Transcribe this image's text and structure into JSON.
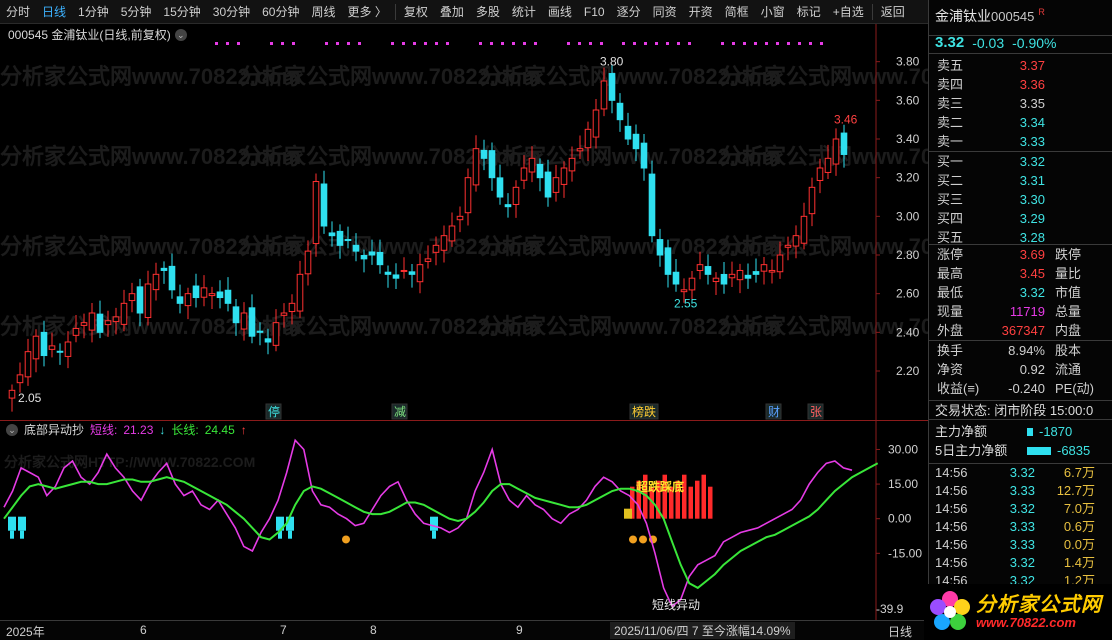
{
  "toolbar": {
    "items": [
      "分时",
      "日线",
      "1分钟",
      "5分钟",
      "15分钟",
      "30分钟",
      "60分钟",
      "周线",
      "更多 〉",
      "复权",
      "叠加",
      "多股",
      "统计",
      "画线",
      "F10",
      "逐分",
      "同资",
      "开资",
      "简框",
      "小窗",
      "标记",
      "+自选",
      "返回"
    ],
    "active": "日线"
  },
  "main": {
    "title": "000545 金浦钛业(日线,前复权)",
    "high_label": "3.80",
    "low_label": "2.55",
    "start_label": "2.05",
    "last_high_label": "3.46",
    "price_ticks": [
      "3.80",
      "3.60",
      "3.40",
      "3.20",
      "3.00",
      "2.80",
      "2.60",
      "2.40",
      "2.20"
    ],
    "event_tags": [
      {
        "text": "停",
        "color": "#3fe3e3"
      },
      {
        "text": "减",
        "color": "#7fe07f"
      },
      {
        "text": "榜跌",
        "color": "#ffcc33"
      },
      {
        "text": "财",
        "color": "#5aa0ff"
      },
      {
        "text": "张",
        "color": "#ff6060"
      }
    ],
    "watermark": "分析家公式网www.70822.com"
  },
  "indicator": {
    "name": "底部异动抄",
    "short_label": "短线:",
    "short_value": "21.23",
    "short_arrow": "↓",
    "long_label": "长线:",
    "long_value": "24.45",
    "long_arrow": "↑",
    "ticks": [
      "30.00",
      "15.00",
      "0.00",
      "-15.00"
    ],
    "min_label": "-39.9",
    "annotation_top": "超跌踩底",
    "annotation_bottom": "短线异动",
    "watermark": "分析家公式网HTTP://WWW.70822.COM"
  },
  "bottom_bar": {
    "year": "2025年",
    "months": [
      "6",
      "7",
      "8",
      "9"
    ],
    "status": "2025/11/06/四 7 至今涨幅14.09%",
    "right": "日线"
  },
  "quote": {
    "name": "金浦钛业",
    "code": "000545",
    "badge": "R",
    "price": "3.32",
    "change": "-0.03",
    "pct": "-0.90%",
    "asks": [
      {
        "label": "卖五",
        "price": "3.37",
        "color": "#ff4040"
      },
      {
        "label": "卖四",
        "price": "3.36",
        "color": "#ff4040"
      },
      {
        "label": "卖三",
        "price": "3.35",
        "color": "#cfcfcf"
      },
      {
        "label": "卖二",
        "price": "3.34",
        "color": "#3fe3e3"
      },
      {
        "label": "卖一",
        "price": "3.33",
        "color": "#3fe3e3"
      }
    ],
    "bids": [
      {
        "label": "买一",
        "price": "3.32",
        "color": "#3fe3e3"
      },
      {
        "label": "买二",
        "price": "3.31",
        "color": "#3fe3e3"
      },
      {
        "label": "买三",
        "price": "3.30",
        "color": "#3fe3e3"
      },
      {
        "label": "买四",
        "price": "3.29",
        "color": "#3fe3e3"
      },
      {
        "label": "买五",
        "price": "3.28",
        "color": "#3fe3e3"
      }
    ],
    "stats": [
      {
        "l1": "涨停",
        "v1": "3.69",
        "c1": "#ff4040",
        "l2": "跌停"
      },
      {
        "l1": "最高",
        "v1": "3.45",
        "c1": "#ff4040",
        "l2": "量比"
      },
      {
        "l1": "最低",
        "v1": "3.32",
        "c1": "#3fe3e3",
        "l2": "市值"
      },
      {
        "l1": "现量",
        "v1": "11719",
        "c1": "#e53be5",
        "l2": "总量"
      },
      {
        "l1": "外盘",
        "v1": "367347",
        "c1": "#ff4040",
        "l2": "内盘"
      }
    ],
    "stats2": [
      {
        "l1": "换手",
        "v1": "8.94%",
        "c1": "#cfcfcf",
        "l2": "股本"
      },
      {
        "l1": "净资",
        "v1": "0.92",
        "c1": "#cfcfcf",
        "l2": "流通"
      },
      {
        "l1": "收益(≡)",
        "v1": "-0.240",
        "c1": "#cfcfcf",
        "l2": "PE(动)"
      }
    ],
    "trade_state": "交易状态: 闭市阶段 15:00:0",
    "flow": [
      {
        "label": "主力净额",
        "value": "-1870"
      },
      {
        "label": "5日主力净额",
        "value": "-6835"
      }
    ],
    "ticks": [
      {
        "t": "14:56",
        "p": "3.32",
        "v": "6.7万",
        "pc": "#3fe3e3"
      },
      {
        "t": "14:56",
        "p": "3.33",
        "v": "12.7万",
        "pc": "#3fe3e3"
      },
      {
        "t": "14:56",
        "p": "3.32",
        "v": "7.0万",
        "pc": "#3fe3e3"
      },
      {
        "t": "14:56",
        "p": "3.33",
        "v": "0.6万",
        "pc": "#3fe3e3"
      },
      {
        "t": "14:56",
        "p": "3.33",
        "v": "0.0万",
        "pc": "#3fe3e3"
      },
      {
        "t": "14:56",
        "p": "3.32",
        "v": "1.4万",
        "pc": "#3fe3e3"
      },
      {
        "t": "14:56",
        "p": "3.32",
        "v": "1.2万",
        "pc": "#3fe3e3"
      }
    ]
  },
  "logo": {
    "text": "分析家公式网",
    "url": "www.70822.com"
  },
  "colors": {
    "up": "#ff3030",
    "down": "#2fe0f0",
    "short_line": "#e53be5",
    "long_line": "#39e639"
  },
  "chart_data": {
    "type": "candlestick",
    "price_axis": {
      "min": 2.05,
      "max": 3.85
    },
    "closes": [
      2.1,
      2.18,
      2.3,
      2.38,
      2.28,
      2.33,
      2.3,
      2.35,
      2.42,
      2.45,
      2.5,
      2.4,
      2.46,
      2.48,
      2.55,
      2.6,
      2.5,
      2.65,
      2.7,
      2.72,
      2.62,
      2.55,
      2.6,
      2.58,
      2.63,
      2.6,
      2.58,
      2.55,
      2.45,
      2.5,
      2.38,
      2.4,
      2.35,
      2.45,
      2.5,
      2.55,
      2.7,
      2.82,
      3.18,
      2.95,
      2.9,
      2.85,
      2.88,
      2.82,
      2.78,
      2.8,
      2.75,
      2.7,
      2.68,
      2.72,
      2.7,
      2.75,
      2.78,
      2.85,
      2.9,
      2.95,
      3.0,
      3.2,
      3.35,
      3.3,
      3.2,
      3.1,
      3.05,
      3.15,
      3.25,
      3.3,
      3.2,
      3.1,
      3.2,
      3.25,
      3.3,
      3.35,
      3.45,
      3.55,
      3.7,
      3.6,
      3.5,
      3.4,
      3.35,
      3.25,
      2.9,
      2.8,
      2.7,
      2.65,
      2.62,
      2.68,
      2.75,
      2.7,
      2.68,
      2.65,
      2.7,
      2.72,
      2.68,
      2.7,
      2.75,
      2.72,
      2.8,
      2.85,
      2.9,
      3.0,
      3.15,
      3.25,
      3.3,
      3.4,
      3.32
    ],
    "short_line": [
      5,
      12,
      22,
      20,
      18,
      10,
      14,
      22,
      25,
      18,
      15,
      20,
      28,
      22,
      18,
      12,
      8,
      15,
      20,
      24,
      15,
      10,
      12,
      6,
      4,
      8,
      2,
      -4,
      -12,
      -14,
      -6,
      0,
      8,
      20,
      34,
      30,
      12,
      6,
      5,
      2,
      0,
      -3,
      -2,
      4,
      10,
      14,
      16,
      8,
      2,
      -2,
      -3,
      -4,
      -6,
      -4,
      0,
      12,
      20,
      30,
      15,
      8,
      5,
      10,
      6,
      4,
      0,
      -2,
      2,
      4,
      8,
      14,
      18,
      16,
      12,
      10,
      6,
      -2,
      -15,
      -30,
      -38,
      -35,
      -25,
      -20,
      -18,
      -16,
      -10,
      -8,
      -6,
      -5,
      -4,
      -2,
      0,
      2,
      4,
      8,
      15,
      20,
      24,
      25,
      22,
      21
    ],
    "long_line": [
      0,
      5,
      10,
      14,
      15,
      14,
      13,
      14,
      15,
      16,
      16,
      15,
      15,
      16,
      17,
      17,
      16,
      16,
      17,
      18,
      17,
      16,
      14,
      12,
      10,
      8,
      6,
      3,
      0,
      -4,
      -8,
      -9,
      -6,
      -2,
      6,
      12,
      14,
      13,
      11,
      9,
      7,
      5,
      3,
      2,
      2,
      3,
      5,
      7,
      7,
      6,
      4,
      2,
      0,
      -1,
      0,
      3,
      7,
      12,
      15,
      15,
      13,
      11,
      9,
      8,
      7,
      6,
      5,
      5,
      6,
      8,
      10,
      12,
      13,
      13,
      12,
      10,
      6,
      0,
      -10,
      -20,
      -28,
      -30,
      -27,
      -24,
      -20,
      -17,
      -14,
      -12,
      -10,
      -8,
      -7,
      -5,
      -3,
      -1,
      1,
      4,
      8,
      12,
      15,
      18,
      20,
      22,
      24
    ]
  }
}
